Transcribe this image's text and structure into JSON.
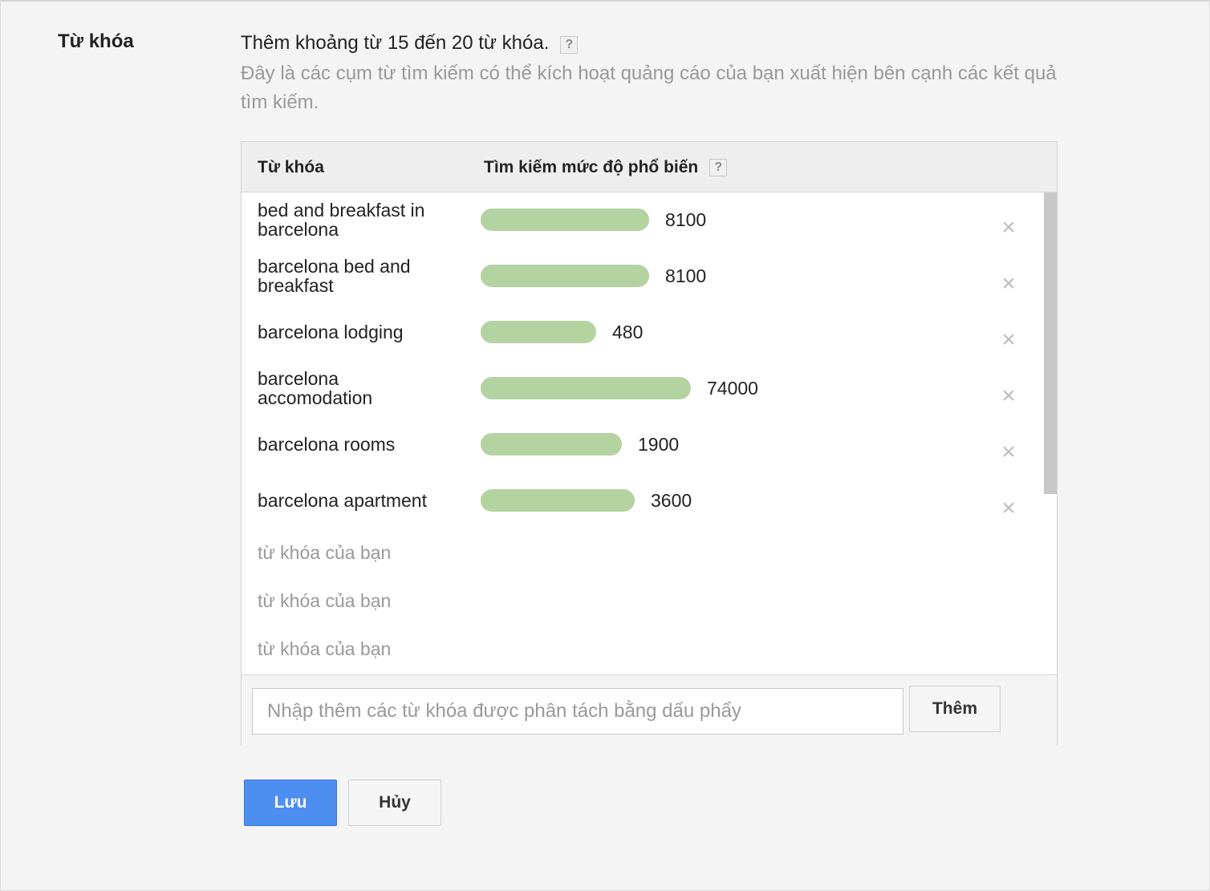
{
  "section": {
    "label": "Từ khóa",
    "heading": "Thêm khoảng từ 15 đến 20 từ khóa.",
    "help_icon": "?",
    "description": "Đây là các cụm từ tìm kiếm có thể kích hoạt quảng cáo của bạn xuất hiện bên cạnh các kết quả tìm kiếm."
  },
  "table": {
    "col_keyword": "Từ khóa",
    "col_popularity": "Tìm kiếm mức độ phổ biến",
    "help_icon": "?",
    "remove_icon": "×",
    "rows": [
      {
        "keyword": "bed and breakfast in barcelona",
        "volume": "8100"
      },
      {
        "keyword": "barcelona bed and breakfast",
        "volume": "8100"
      },
      {
        "keyword": "barcelona lodging",
        "volume": "480"
      },
      {
        "keyword": "barcelona accomodation",
        "volume": "74000"
      },
      {
        "keyword": "barcelona rooms",
        "volume": "1900"
      },
      {
        "keyword": "barcelona apartment",
        "volume": "3600"
      }
    ],
    "empty_rows": [
      "từ khóa của bạn",
      "từ khóa của bạn",
      "từ khóa của bạn"
    ]
  },
  "add": {
    "placeholder": "Nhập thêm các từ khóa được phân tách bằng dấu phẩy",
    "button": "Thêm"
  },
  "actions": {
    "save": "Lưu",
    "cancel": "Hủy"
  },
  "colors": {
    "bar": "#b3d3a1",
    "primary": "#4d8ef1"
  }
}
